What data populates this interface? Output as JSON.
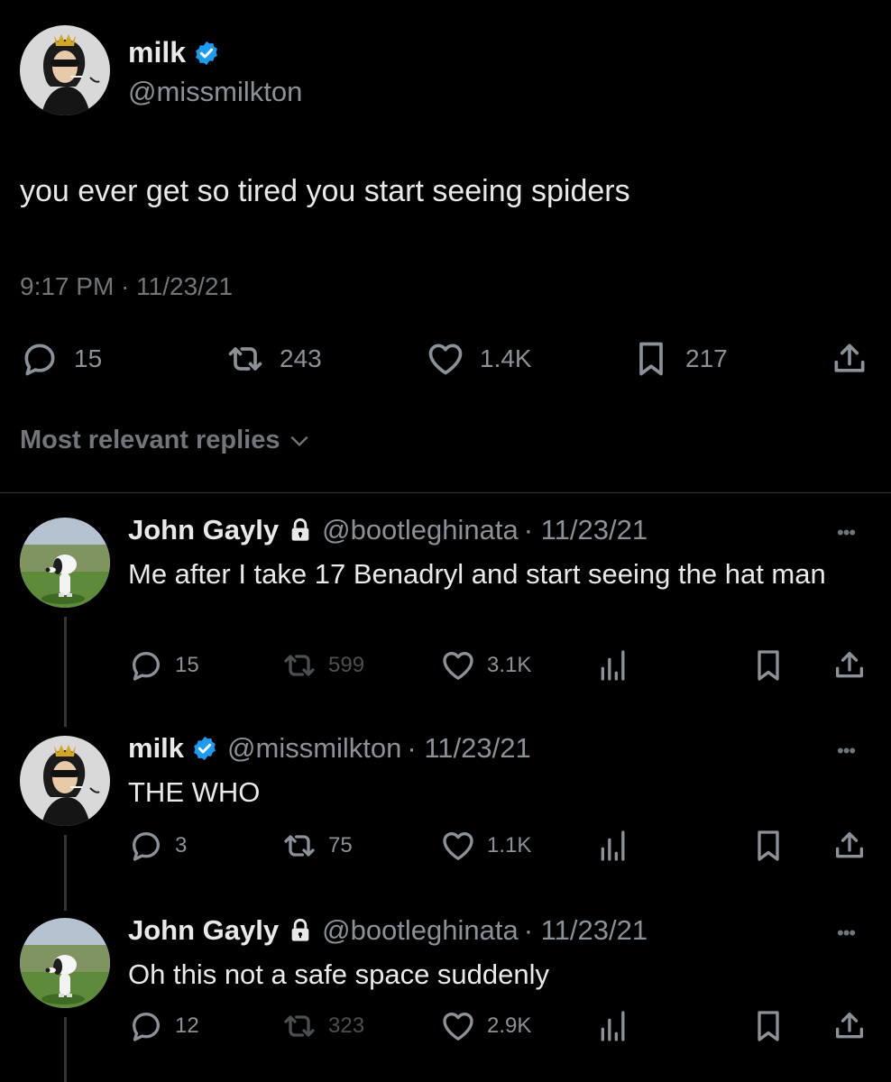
{
  "main_tweet": {
    "name": "milk",
    "handle": "@missmilkton",
    "text": "you ever get so tired you start seeing spiders",
    "timestamp": "9:17 PM · 11/23/21",
    "stats": {
      "replies": "15",
      "retweets": "243",
      "likes": "1.4K",
      "bookmarks": "217"
    }
  },
  "replies_filter_label": "Most relevant replies",
  "replies": [
    {
      "name": "John Gayly",
      "handle": "@bootleghinata",
      "date": "· 11/23/21",
      "text": "Me after I take 17 Benadryl and start seeing the hat man",
      "replies": "15",
      "retweets": "599",
      "likes": "3.1K"
    },
    {
      "name": "milk",
      "handle": "@missmilkton",
      "date": "· 11/23/21",
      "text": "THE WHO",
      "replies": "3",
      "retweets": "75",
      "likes": "1.1K"
    },
    {
      "name": "John Gayly",
      "handle": "@bootleghinata",
      "date": "· 11/23/21",
      "text": "Oh this not a safe space suddenly",
      "replies": "12",
      "retweets": "323",
      "likes": "2.9K"
    }
  ],
  "colors": {
    "background": "#000000",
    "text": "#e7e9ea",
    "muted": "#71767b",
    "verified": "#1d9bf0"
  }
}
